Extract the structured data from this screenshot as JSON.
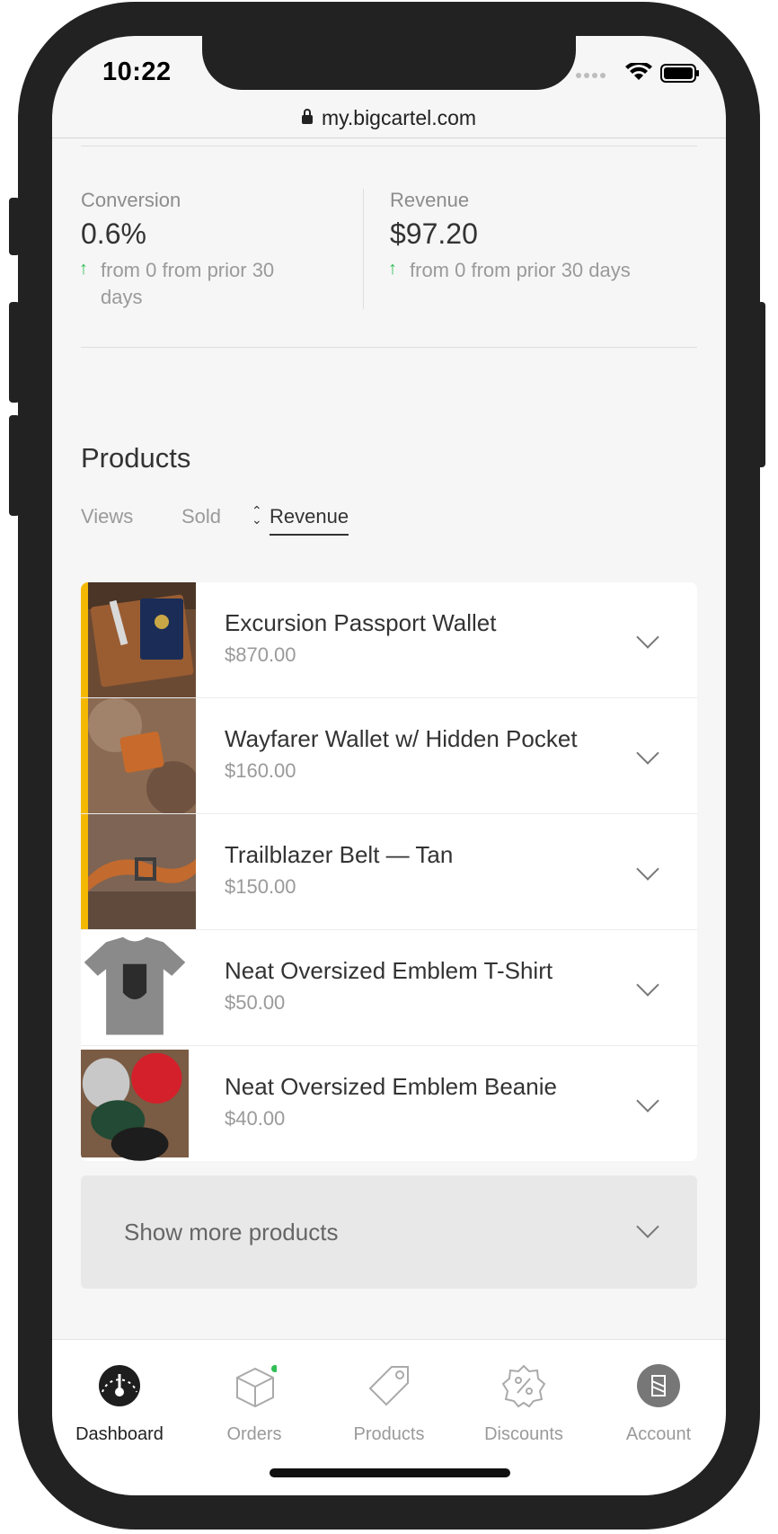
{
  "status_bar": {
    "time": "10:22"
  },
  "browser": {
    "url": "my.bigcartel.com"
  },
  "stats": [
    {
      "label": "Conversion",
      "value": "0.6%",
      "trend": "from 0 from prior 30 days"
    },
    {
      "label": "Revenue",
      "value": "$97.20",
      "trend": "from 0 from prior 30 days"
    }
  ],
  "products": {
    "title": "Products",
    "tabs": [
      "Views",
      "Sold",
      "Revenue"
    ],
    "active_tab": "Revenue",
    "items": [
      {
        "name": "Excursion Passport Wallet",
        "price": "$870.00",
        "highlighted": true
      },
      {
        "name": "Wayfarer Wallet w/ Hidden Pocket",
        "price": "$160.00",
        "highlighted": true
      },
      {
        "name": "Trailblazer Belt — Tan",
        "price": "$150.00",
        "highlighted": true
      },
      {
        "name": "Neat Oversized Emblem T-Shirt",
        "price": "$50.00",
        "highlighted": false
      },
      {
        "name": "Neat Oversized Emblem Beanie",
        "price": "$40.00",
        "highlighted": false
      }
    ],
    "show_more": "Show more products"
  },
  "tabbar": {
    "items": [
      {
        "label": "Dashboard",
        "icon": "gauge-icon"
      },
      {
        "label": "Orders",
        "icon": "box-icon"
      },
      {
        "label": "Products",
        "icon": "tag-icon"
      },
      {
        "label": "Discounts",
        "icon": "percent-badge-icon"
      },
      {
        "label": "Account",
        "icon": "account-avatar-icon"
      }
    ],
    "active": "Dashboard"
  },
  "colors": {
    "accent_stripe": "#f5b800",
    "trend_up": "#2fbf55",
    "notification_dot": "#2fbf55"
  }
}
